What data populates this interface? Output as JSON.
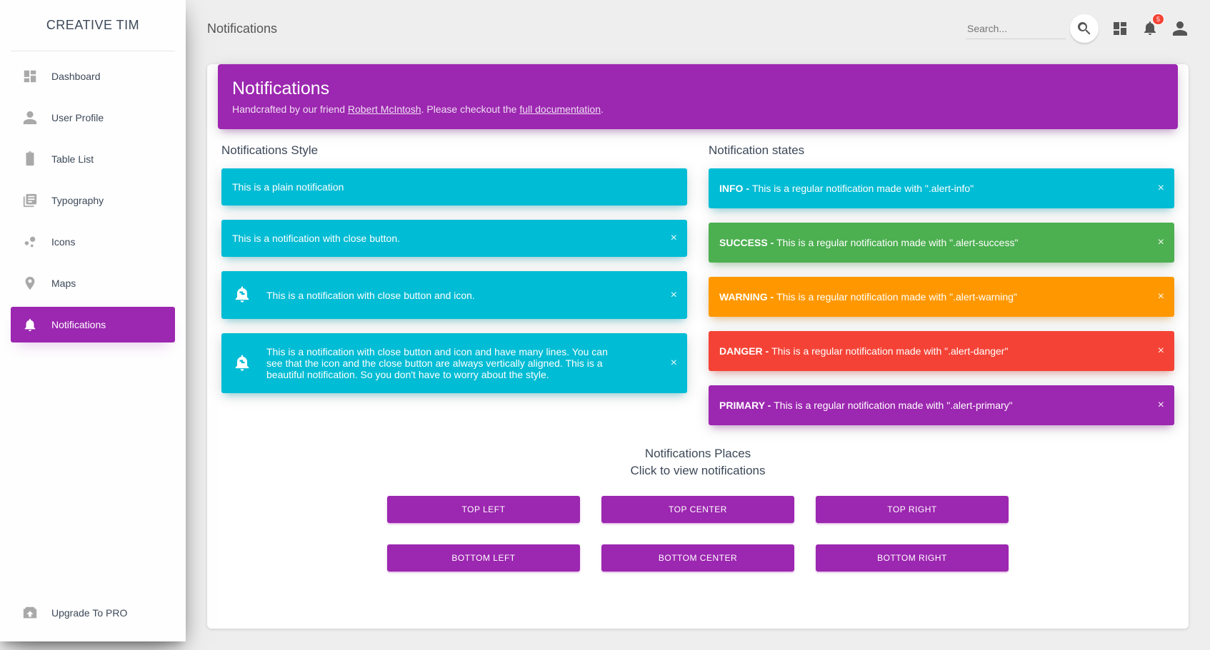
{
  "brand": "CREATIVE TIM",
  "sidebar": {
    "items": [
      {
        "label": "Dashboard"
      },
      {
        "label": "User Profile"
      },
      {
        "label": "Table List"
      },
      {
        "label": "Typography"
      },
      {
        "label": "Icons"
      },
      {
        "label": "Maps"
      },
      {
        "label": "Notifications"
      }
    ],
    "upgrade": "Upgrade To PRO"
  },
  "topbar": {
    "title": "Notifications",
    "search_placeholder": "Search...",
    "badge_count": "5"
  },
  "header": {
    "title": "Notifications",
    "subtitle_before": "Handcrafted by our friend ",
    "author": "Robert McIntosh",
    "subtitle_mid": ". Please checkout the ",
    "doc_link": "full documentation",
    "subtitle_after": "."
  },
  "left_section_title": "Notifications Style",
  "right_section_title": "Notification states",
  "style_alerts": {
    "plain": "This is a plain notification",
    "with_close": "This is a notification with close button.",
    "with_icon": "This is a notification with close button and icon.",
    "long": "This is a notification with close button and icon and have many lines. You can see that the icon and the close button are always vertically aligned. This is a beautiful notification. So you don't have to worry about the style."
  },
  "state_alerts": {
    "info": {
      "tag": "INFO - ",
      "text": "This is a regular notification made with \".alert-info\""
    },
    "success": {
      "tag": "SUCCESS - ",
      "text": "This is a regular notification made with \".alert-success\""
    },
    "warning": {
      "tag": "WARNING - ",
      "text": "This is a regular notification made with \".alert-warning\""
    },
    "danger": {
      "tag": "DANGER - ",
      "text": "This is a regular notification made with \".alert-danger\""
    },
    "primary": {
      "tag": "PRIMARY - ",
      "text": "This is a regular notification made with \".alert-primary\""
    }
  },
  "places": {
    "title": "Notifications Places",
    "subtitle": "Click to view notifications",
    "buttons": {
      "tl": "TOP LEFT",
      "tc": "TOP CENTER",
      "tr": "TOP RIGHT",
      "bl": "BOTTOM LEFT",
      "bc": "BOTTOM CENTER",
      "br": "BOTTOM RIGHT"
    }
  }
}
